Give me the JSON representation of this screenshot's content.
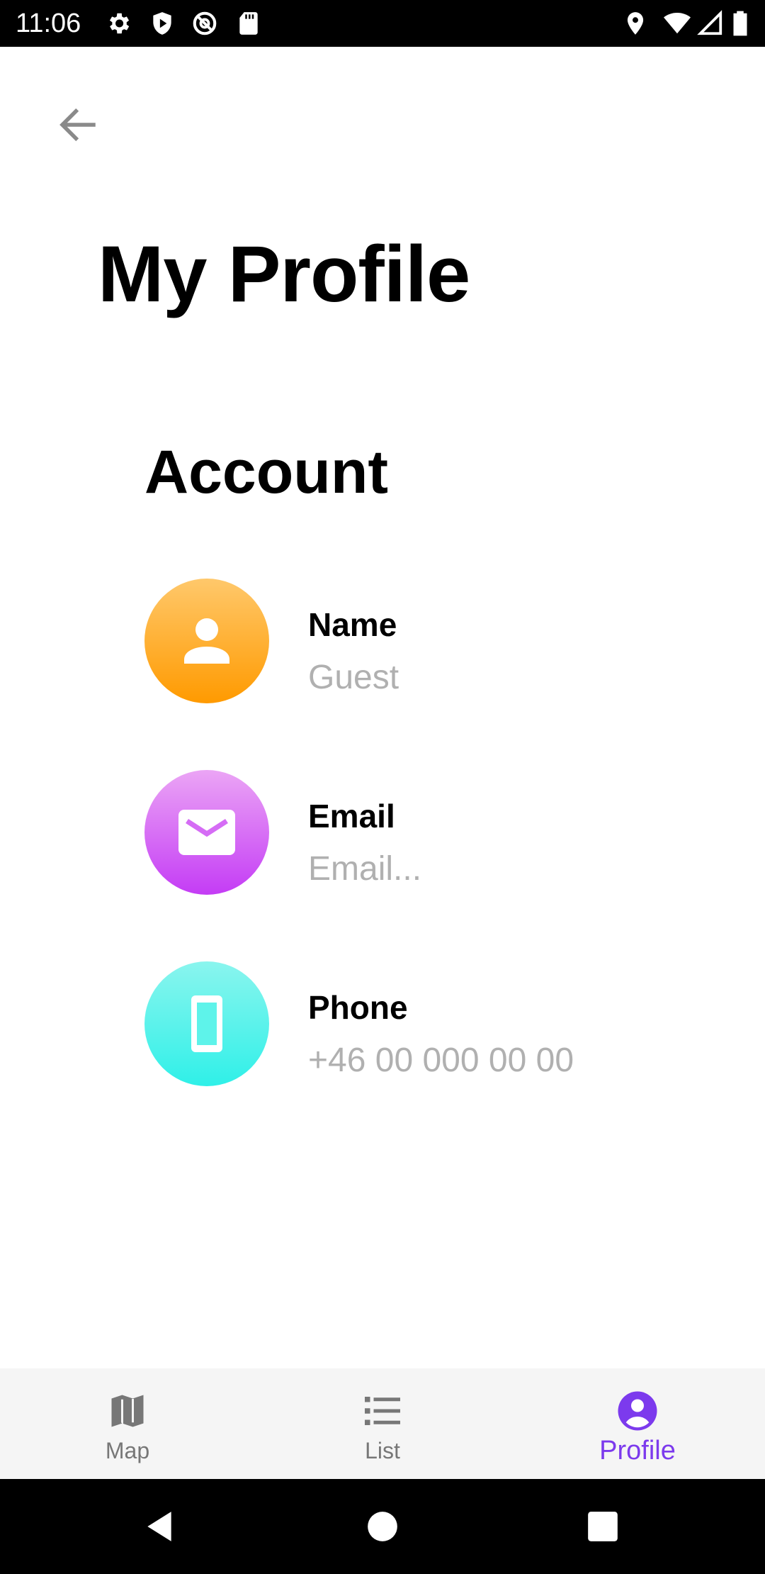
{
  "status_bar": {
    "time": "11:06",
    "left_icons": [
      "settings-icon",
      "shield-play-icon",
      "at-sign-icon",
      "sd-card-icon"
    ],
    "right_icons": [
      "location-icon",
      "wifi-icon",
      "signal-icon",
      "battery-icon"
    ]
  },
  "header": {
    "back_icon": "arrow-left-icon",
    "title": "My Profile"
  },
  "account": {
    "section_title": "Account",
    "items": [
      {
        "label": "Name",
        "value": "Guest",
        "icon": "person-icon",
        "gradient": [
          "#ffc86b",
          "#ff9a00"
        ]
      },
      {
        "label": "Email",
        "placeholder": "Email...",
        "icon": "mail-icon",
        "gradient": [
          "#eba5f5",
          "#c43cf5"
        ]
      },
      {
        "label": "Phone",
        "placeholder": "+46 00 000 00 00",
        "icon": "phone-icon",
        "gradient": [
          "#8af5ee",
          "#2ff0e8"
        ]
      }
    ]
  },
  "bottom_nav": {
    "items": [
      {
        "label": "Map",
        "icon": "map-icon",
        "active": false
      },
      {
        "label": "List",
        "icon": "list-icon",
        "active": false
      },
      {
        "label": "Profile",
        "icon": "account-circle-icon",
        "active": true
      }
    ],
    "active_color": "#7c3aed",
    "inactive_color": "#777777"
  },
  "system_nav": {
    "buttons": [
      "back-triangle-icon",
      "home-circle-icon",
      "recents-square-icon"
    ]
  }
}
